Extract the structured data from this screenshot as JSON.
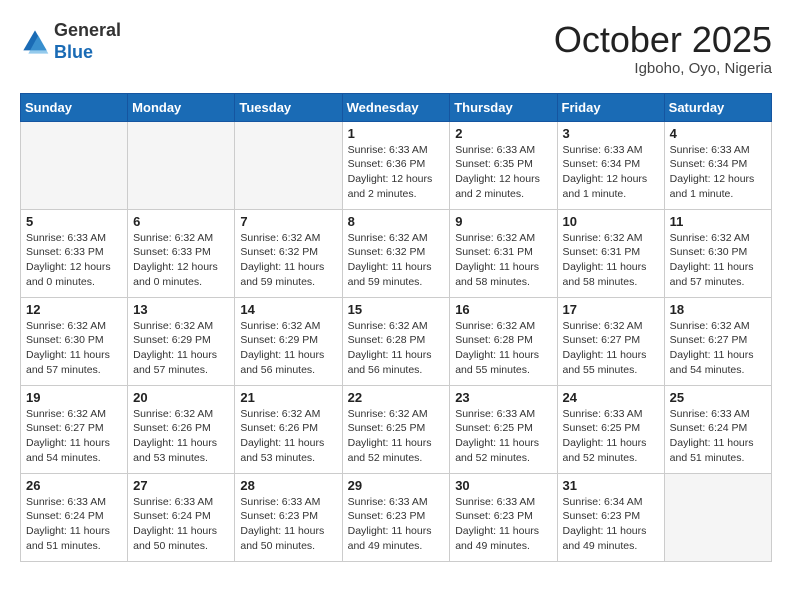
{
  "header": {
    "logo_general": "General",
    "logo_blue": "Blue",
    "month": "October 2025",
    "location": "Igboho, Oyo, Nigeria"
  },
  "weekdays": [
    "Sunday",
    "Monday",
    "Tuesday",
    "Wednesday",
    "Thursday",
    "Friday",
    "Saturday"
  ],
  "weeks": [
    [
      {
        "day": "",
        "info": ""
      },
      {
        "day": "",
        "info": ""
      },
      {
        "day": "",
        "info": ""
      },
      {
        "day": "1",
        "info": "Sunrise: 6:33 AM\nSunset: 6:36 PM\nDaylight: 12 hours\nand 2 minutes."
      },
      {
        "day": "2",
        "info": "Sunrise: 6:33 AM\nSunset: 6:35 PM\nDaylight: 12 hours\nand 2 minutes."
      },
      {
        "day": "3",
        "info": "Sunrise: 6:33 AM\nSunset: 6:34 PM\nDaylight: 12 hours\nand 1 minute."
      },
      {
        "day": "4",
        "info": "Sunrise: 6:33 AM\nSunset: 6:34 PM\nDaylight: 12 hours\nand 1 minute."
      }
    ],
    [
      {
        "day": "5",
        "info": "Sunrise: 6:33 AM\nSunset: 6:33 PM\nDaylight: 12 hours\nand 0 minutes."
      },
      {
        "day": "6",
        "info": "Sunrise: 6:32 AM\nSunset: 6:33 PM\nDaylight: 12 hours\nand 0 minutes."
      },
      {
        "day": "7",
        "info": "Sunrise: 6:32 AM\nSunset: 6:32 PM\nDaylight: 11 hours\nand 59 minutes."
      },
      {
        "day": "8",
        "info": "Sunrise: 6:32 AM\nSunset: 6:32 PM\nDaylight: 11 hours\nand 59 minutes."
      },
      {
        "day": "9",
        "info": "Sunrise: 6:32 AM\nSunset: 6:31 PM\nDaylight: 11 hours\nand 58 minutes."
      },
      {
        "day": "10",
        "info": "Sunrise: 6:32 AM\nSunset: 6:31 PM\nDaylight: 11 hours\nand 58 minutes."
      },
      {
        "day": "11",
        "info": "Sunrise: 6:32 AM\nSunset: 6:30 PM\nDaylight: 11 hours\nand 57 minutes."
      }
    ],
    [
      {
        "day": "12",
        "info": "Sunrise: 6:32 AM\nSunset: 6:30 PM\nDaylight: 11 hours\nand 57 minutes."
      },
      {
        "day": "13",
        "info": "Sunrise: 6:32 AM\nSunset: 6:29 PM\nDaylight: 11 hours\nand 57 minutes."
      },
      {
        "day": "14",
        "info": "Sunrise: 6:32 AM\nSunset: 6:29 PM\nDaylight: 11 hours\nand 56 minutes."
      },
      {
        "day": "15",
        "info": "Sunrise: 6:32 AM\nSunset: 6:28 PM\nDaylight: 11 hours\nand 56 minutes."
      },
      {
        "day": "16",
        "info": "Sunrise: 6:32 AM\nSunset: 6:28 PM\nDaylight: 11 hours\nand 55 minutes."
      },
      {
        "day": "17",
        "info": "Sunrise: 6:32 AM\nSunset: 6:27 PM\nDaylight: 11 hours\nand 55 minutes."
      },
      {
        "day": "18",
        "info": "Sunrise: 6:32 AM\nSunset: 6:27 PM\nDaylight: 11 hours\nand 54 minutes."
      }
    ],
    [
      {
        "day": "19",
        "info": "Sunrise: 6:32 AM\nSunset: 6:27 PM\nDaylight: 11 hours\nand 54 minutes."
      },
      {
        "day": "20",
        "info": "Sunrise: 6:32 AM\nSunset: 6:26 PM\nDaylight: 11 hours\nand 53 minutes."
      },
      {
        "day": "21",
        "info": "Sunrise: 6:32 AM\nSunset: 6:26 PM\nDaylight: 11 hours\nand 53 minutes."
      },
      {
        "day": "22",
        "info": "Sunrise: 6:32 AM\nSunset: 6:25 PM\nDaylight: 11 hours\nand 52 minutes."
      },
      {
        "day": "23",
        "info": "Sunrise: 6:33 AM\nSunset: 6:25 PM\nDaylight: 11 hours\nand 52 minutes."
      },
      {
        "day": "24",
        "info": "Sunrise: 6:33 AM\nSunset: 6:25 PM\nDaylight: 11 hours\nand 52 minutes."
      },
      {
        "day": "25",
        "info": "Sunrise: 6:33 AM\nSunset: 6:24 PM\nDaylight: 11 hours\nand 51 minutes."
      }
    ],
    [
      {
        "day": "26",
        "info": "Sunrise: 6:33 AM\nSunset: 6:24 PM\nDaylight: 11 hours\nand 51 minutes."
      },
      {
        "day": "27",
        "info": "Sunrise: 6:33 AM\nSunset: 6:24 PM\nDaylight: 11 hours\nand 50 minutes."
      },
      {
        "day": "28",
        "info": "Sunrise: 6:33 AM\nSunset: 6:23 PM\nDaylight: 11 hours\nand 50 minutes."
      },
      {
        "day": "29",
        "info": "Sunrise: 6:33 AM\nSunset: 6:23 PM\nDaylight: 11 hours\nand 49 minutes."
      },
      {
        "day": "30",
        "info": "Sunrise: 6:33 AM\nSunset: 6:23 PM\nDaylight: 11 hours\nand 49 minutes."
      },
      {
        "day": "31",
        "info": "Sunrise: 6:34 AM\nSunset: 6:23 PM\nDaylight: 11 hours\nand 49 minutes."
      },
      {
        "day": "",
        "info": ""
      }
    ]
  ]
}
